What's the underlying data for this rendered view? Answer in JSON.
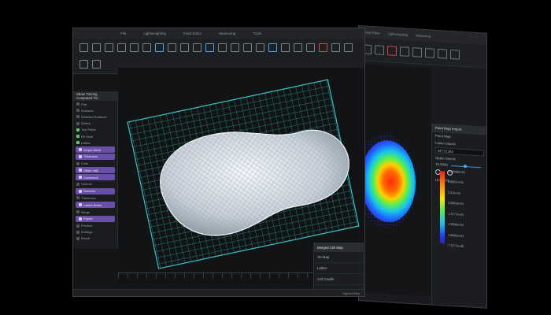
{
  "back_window": {
    "tabs": [
      "Point Editor",
      "Lightweighting",
      "Measuring"
    ],
    "panel": {
      "header": "Point Map Import",
      "point_map_label": "Point Map",
      "lower_bound_label": "Lower bound",
      "lower_bound_value": "6E721340",
      "upper_bound_label": "Upper bound",
      "upper_bound_value": "10.0000",
      "unit_label": "Units: Pa"
    },
    "legend_values": [
      "3.46998e+01",
      "2.9967e+01",
      "2.47e+01",
      "2.0953e+01",
      "1.7277e+01",
      "1.3688e+01",
      "1.0082e+01",
      "7.7277e+00"
    ],
    "status": "Highest Res"
  },
  "front_window": {
    "tabs": [
      "File",
      "Lightweighting",
      "Point Editor",
      "Measuring",
      "Tools"
    ],
    "left_panel": {
      "header": "Show Tracing Computed Fin",
      "items": [
        {
          "label": "Part",
          "style": "plain"
        },
        {
          "label": "Surfaces",
          "style": "plain"
        },
        {
          "label": "Selected Surfaces",
          "style": "plain"
        },
        {
          "label": "Sketch",
          "style": "plain"
        },
        {
          "label": "Tool Paths",
          "style": "green"
        },
        {
          "label": "Fill Shell",
          "style": "green"
        },
        {
          "label": "Lattice",
          "style": "green"
        },
        {
          "label": "Graph Mesh",
          "style": "purple"
        },
        {
          "label": "Thickness",
          "style": "purple"
        },
        {
          "label": "Cells",
          "style": "plain"
        },
        {
          "label": "Offset Infill",
          "style": "purple"
        },
        {
          "label": "Conformal",
          "style": "purple"
        },
        {
          "label": "Voronoi",
          "style": "plain"
        },
        {
          "label": "Remesh",
          "style": "purple"
        },
        {
          "label": "Thickened",
          "style": "plain"
        },
        {
          "label": "Lattice Beam",
          "style": "purple"
        },
        {
          "label": "Merge",
          "style": "plain"
        },
        {
          "label": "Export",
          "style": "purple"
        },
        {
          "label": "Preview",
          "style": "plain"
        },
        {
          "label": "Settings",
          "style": "plain"
        },
        {
          "label": "Result",
          "style": "plain"
        }
      ]
    },
    "right_panel": {
      "header": "Merged Cell Map",
      "rows": [
        "Tet Map",
        "Lattice",
        "Cell Cradle"
      ]
    },
    "status": "Highest Res"
  },
  "colors": {
    "wire": "#39c2c4",
    "lattice": "#e8eef3",
    "accent": "#6a4fa8"
  }
}
